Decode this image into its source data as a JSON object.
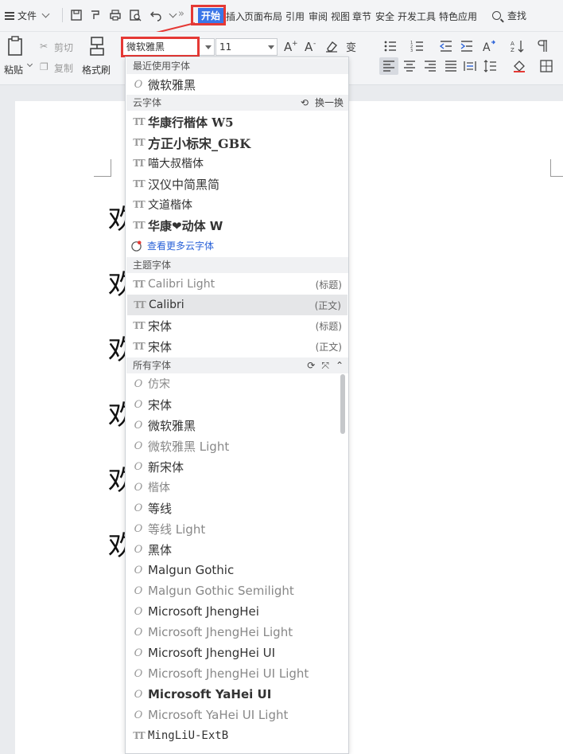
{
  "menubar": {
    "file_label": "文件",
    "more_symbol": "»",
    "active_tab": "开始",
    "tabs": [
      "插入",
      "页面布局",
      "引用",
      "审阅",
      "视图",
      "章节",
      "安全",
      "开发工具",
      "特色应用"
    ],
    "search_label": "查找"
  },
  "ribbon": {
    "paste_label": "粘贴",
    "cut_label": "剪切",
    "copy_label": "复制",
    "format_painter_label": "格式刷",
    "font_value": "微软雅黑",
    "size_value": "11"
  },
  "document": {
    "chars": [
      "欢",
      "欢",
      "欢",
      "欢",
      "欢",
      "欢"
    ]
  },
  "font_panel": {
    "recent_header": "最近使用字体",
    "recent": [
      "微软雅黑"
    ],
    "cloud_header": "云字体",
    "cloud_swap_label": "换一换",
    "cloud": [
      "华康行楷体 W5",
      "方正小标宋_GBK",
      "喵大叔楷体",
      "汉仪中简黑简",
      "文道楷体",
      "华康❤动体 W"
    ],
    "more_cloud_label": "查看更多云字体",
    "theme_header": "主题字体",
    "theme": [
      {
        "name": "Calibri Light",
        "tag": "(标题)"
      },
      {
        "name": "Calibri",
        "tag": "(正文)"
      },
      {
        "name": "宋体",
        "tag": "(标题)"
      },
      {
        "name": "宋体",
        "tag": "(正文)"
      }
    ],
    "all_header": "所有字体",
    "all": [
      "仿宋",
      "宋体",
      "微软雅黑",
      "微软雅黑 Light",
      "新宋体",
      "楷体",
      "等线",
      "等线 Light",
      "黑体",
      "Malgun Gothic",
      "Malgun Gothic Semilight",
      "Microsoft JhengHei",
      "Microsoft JhengHei Light",
      "Microsoft JhengHei UI",
      "Microsoft JhengHei UI Light",
      "Microsoft YaHei UI",
      "Microsoft YaHei UI Light",
      "MingLiU-ExtB"
    ]
  }
}
